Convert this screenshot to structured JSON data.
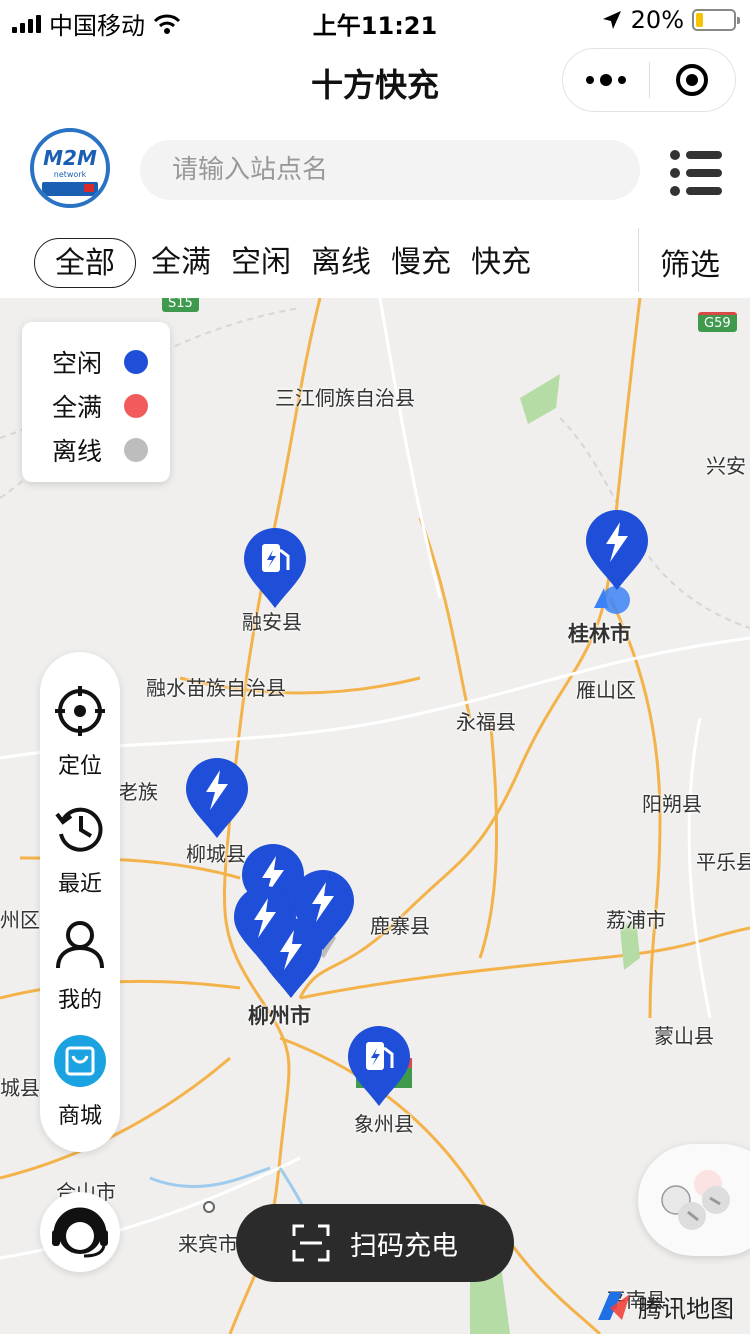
{
  "status": {
    "carrier": "中国移动",
    "time": "上午11:21",
    "battery": "20%",
    "battery_level": 0.2
  },
  "nav": {
    "title": "十方快充"
  },
  "logo": {
    "line1": "M2M",
    "line2": "network"
  },
  "search": {
    "placeholder": "请输入站点名"
  },
  "filters": {
    "tabs": [
      "全部",
      "全满",
      "空闲",
      "离线",
      "慢充",
      "快充"
    ],
    "active": "全部",
    "filter_label": "筛选"
  },
  "legend": [
    {
      "label": "空闲",
      "color": "#1f4fd8"
    },
    {
      "label": "全满",
      "color": "#f25b5b"
    },
    {
      "label": "离线",
      "color": "#bdbdbd"
    }
  ],
  "map": {
    "roads": {
      "s15": "S15",
      "g59": "G59"
    },
    "labels": {
      "sanjiang": "三江侗族自治县",
      "xingan": "兴安",
      "rongan": "融安县",
      "guilin": "桂林市",
      "yanshan": "雁山区",
      "rongshui": "融水苗族自治县",
      "yongfu": "永福县",
      "liucheng": "柳城县",
      "yangshuo": "阳朔县",
      "pingle": "平乐县",
      "luzhai": "鹿寨县",
      "lipu": "荔浦市",
      "liuzhou": "柳州市",
      "mengshan": "蒙山县",
      "xiangzhou": "象州县",
      "heshan": "合山市",
      "laibin": "来宾市",
      "zhou": "州区",
      "cheng": "城县",
      "zu": "老族",
      "jinxiu": "平南县"
    }
  },
  "sidebar": {
    "locate": "定位",
    "recent": "最近",
    "mine": "我的",
    "mall": "商城"
  },
  "scan": {
    "label": "扫码充电"
  },
  "watermark": {
    "label": "腾讯地图"
  }
}
